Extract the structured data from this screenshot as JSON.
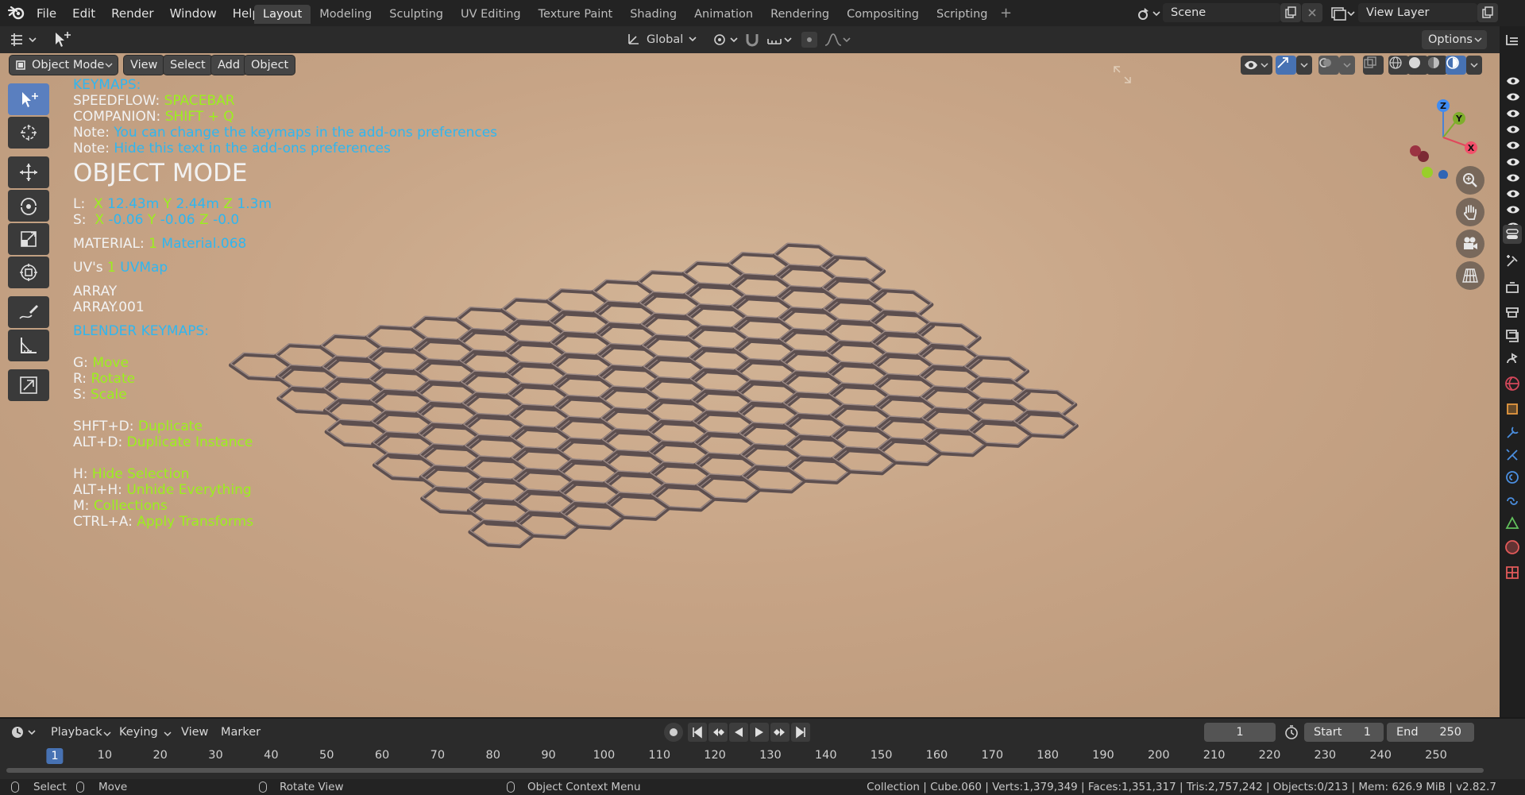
{
  "menubar": {
    "items": [
      "File",
      "Edit",
      "Render",
      "Window",
      "Help"
    ],
    "workspaces": [
      "Layout",
      "Modeling",
      "Sculpting",
      "UV Editing",
      "Texture Paint",
      "Shading",
      "Animation",
      "Rendering",
      "Compositing",
      "Scripting"
    ],
    "active_workspace": "Layout",
    "scene": "Scene",
    "view_layer": "View Layer"
  },
  "viewport_header": {
    "transform_orientation": "Global",
    "options_label": "Options",
    "mode": "Object Mode",
    "menus": [
      "View",
      "Select",
      "Add",
      "Object"
    ]
  },
  "overlay": {
    "keymaps_title": "KEYMAPS:",
    "speedflow_label": "SPEEDFLOW:",
    "speedflow_key": "SPACEBAR",
    "companion_label": "COMPANION:",
    "companion_key": "SHIFT + Q",
    "note_label": "Note:",
    "note1": "You can change the keymaps in the add-ons preferences",
    "note2": "Hide this text in the add-ons preferences",
    "mode_title": "OBJECT MODE",
    "loc_label": "L:",
    "loc": {
      "x_label": "X",
      "x": "12.43m",
      "y_label": "Y",
      "y": "2.44m",
      "z_label": "Z",
      "z": "1.3m"
    },
    "scale_label": "S:",
    "scale": {
      "x_label": "X",
      "x": "-0.06",
      "y_label": "Y",
      "y": "-0.06",
      "z_label": "Z",
      "z": "-0.0"
    },
    "material_label": "MATERIAL:",
    "material_count": "1",
    "material_name": "Material.068",
    "uv_label": "UV's",
    "uv_count": "1",
    "uv_name": "UVMap",
    "modifiers": [
      "ARRAY",
      "ARRAY.001"
    ],
    "blender_keymaps_title": "BLENDER KEYMAPS:",
    "shortcuts_a": [
      {
        "key": "G:",
        "action": "Move"
      },
      {
        "key": "R:",
        "action": "Rotate"
      },
      {
        "key": "S:",
        "action": "Scale"
      }
    ],
    "shortcuts_b": [
      {
        "key": "SHFT+D:",
        "action": "Duplicate"
      },
      {
        "key": "ALT+D:",
        "action": "Duplicate Instance"
      }
    ],
    "shortcuts_c": [
      {
        "key": "H:",
        "action": "Hide Selection"
      },
      {
        "key": "ALT+H:",
        "action": "Unhide Everything"
      },
      {
        "key": "M:",
        "action": "Collections"
      },
      {
        "key": "CTRL+A:",
        "action": "Apply Transforms"
      }
    ]
  },
  "gizmo": {
    "z": "Z",
    "y": "Y",
    "x": "X"
  },
  "timeline": {
    "menus": [
      "Playback",
      "Keying",
      "View",
      "Marker"
    ],
    "current_frame": "1",
    "start_label": "Start",
    "start": "1",
    "end_label": "End",
    "end": "250",
    "ruler": [
      "10",
      "20",
      "30",
      "40",
      "50",
      "60",
      "70",
      "80",
      "90",
      "100",
      "110",
      "120",
      "130",
      "140",
      "150",
      "160",
      "170",
      "180",
      "190",
      "200",
      "210",
      "220",
      "230",
      "240",
      "250"
    ]
  },
  "statusbar": {
    "select": "Select",
    "move": "Move",
    "rotate_view": "Rotate View",
    "context_menu": "Object Context Menu",
    "stats": "Collection | Cube.060 | Verts:1,379,349 | Faces:1,351,317 | Tris:2,757,242 | Objects:0/213 | Mem: 626.9 MiB | v2.82.7"
  },
  "colors": {
    "accent": "#4772b3",
    "overlay_blue": "#2fb6f0",
    "overlay_green": "#9bf01d",
    "viewport_bg": "#c9a687"
  }
}
